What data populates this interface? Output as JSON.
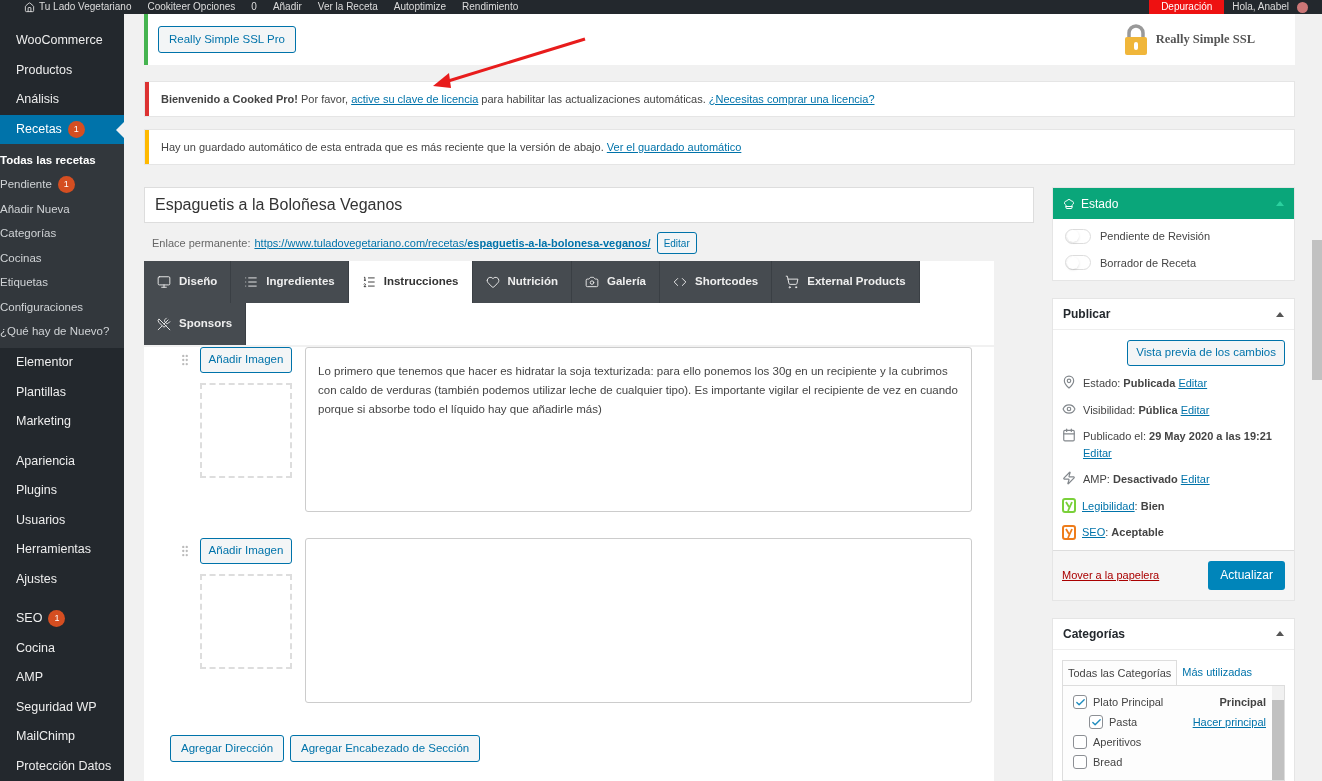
{
  "admin_bar": {
    "items": [
      "Tu Lado Vegetariano",
      "Cookiteer Opciones",
      "0",
      "Añadir",
      "Ver la Receta",
      "Autoptimize",
      "Rendimiento"
    ],
    "debug": "Depuración",
    "greeting": "Hola, Anabel"
  },
  "sidebar": {
    "items": [
      {
        "label": "WooCommerce",
        "selected": false
      },
      {
        "label": "Productos",
        "selected": false
      },
      {
        "label": "Análisis",
        "selected": false
      },
      {
        "label": "Recetas",
        "badge": "1",
        "selected": true,
        "children": [
          {
            "label": "Todas las recetas",
            "selected": true
          },
          {
            "label": "Pendiente",
            "badge": "1",
            "selected": false
          },
          {
            "label": "Añadir Nueva",
            "selected": false
          },
          {
            "label": "Categorías",
            "selected": false
          },
          {
            "label": "Cocinas",
            "selected": false
          },
          {
            "label": "Etiquetas",
            "selected": false
          },
          {
            "label": "Configuraciones",
            "selected": false
          },
          {
            "label": "¿Qué hay de Nuevo?",
            "selected": false
          }
        ]
      },
      {
        "label": "Elementor",
        "selected": false
      },
      {
        "label": "Plantillas",
        "selected": false
      },
      {
        "label": "Marketing",
        "selected": false,
        "gap": true
      },
      {
        "label": "Apariencia",
        "selected": false
      },
      {
        "label": "Plugins",
        "selected": false
      },
      {
        "label": "Usuarios",
        "selected": false
      },
      {
        "label": "Herramientas",
        "selected": false
      },
      {
        "label": "Ajustes",
        "selected": false,
        "gap": true
      },
      {
        "label": "SEO",
        "badge": "1",
        "selected": false
      },
      {
        "label": "Cocina",
        "selected": false
      },
      {
        "label": "AMP",
        "selected": false
      },
      {
        "label": "Seguridad WP",
        "selected": false
      },
      {
        "label": "MailChimp",
        "selected": false
      },
      {
        "label": "Protección Datos",
        "selected": false
      }
    ]
  },
  "notices": [
    {
      "kind": "ssl",
      "color": "#46b450",
      "button": "Really Simple SSL Pro",
      "logo_text": "Really Simple SSL"
    },
    {
      "kind": "message",
      "color": "#dc3232",
      "parts": [
        {
          "text": "**Bienvenido a Cooked Pro!** Por favor, "
        },
        {
          "link": "active su clave de licencia"
        },
        {
          "text": " para habilitar las actualizaciones automáticas. "
        },
        {
          "link": "¿Necesitas comprar una licencia?"
        }
      ]
    },
    {
      "kind": "message",
      "color": "#ffb900",
      "parts": [
        {
          "text": "Hay un guardado automático de esta entrada que es más reciente que la versión de abajo. "
        },
        {
          "link": "Ver el guardado automático"
        }
      ]
    }
  ],
  "title": "Espaguetis a la Boloñesa Veganos",
  "permalink": {
    "label": "Enlace permanente:",
    "url_base": "https://www.tuladovegetariano.com/recetas/",
    "url_slug": "espaguetis-a-la-bolonesa-veganos/",
    "button": "Editar"
  },
  "tabs": [
    {
      "kind": "monitor",
      "label": "Diseño",
      "selected": false
    },
    {
      "kind": "list",
      "label": "Ingredientes",
      "selected": false
    },
    {
      "kind": "ordered",
      "label": "Instrucciones",
      "selected": true
    },
    {
      "kind": "heart",
      "label": "Nutrición",
      "selected": false
    },
    {
      "kind": "camera",
      "label": "Galería",
      "selected": false
    },
    {
      "kind": "code",
      "label": "Shortcodes",
      "selected": false
    },
    {
      "kind": "cart",
      "label": "External Products",
      "selected": false
    },
    {
      "kind": "utensils",
      "label": "Sponsors",
      "selected": false
    }
  ],
  "steps": [
    {
      "button": "Añadir Imagen",
      "text": "Lo primero que tenemos que hacer es hidratar la soja texturizada: para ello ponemos los 30g en un recipiente y la cubrimos con caldo de verduras (también podemos utilizar leche de cualquier tipo). Es importante vigilar el recipiente de vez en cuando porque si absorbe todo el líquido hay que añadirle más)"
    },
    {
      "button": "Añadir Imagen"
    }
  ],
  "step_buttons": [
    "Agregar Dirección",
    "Agregar Encabezado de Sección"
  ],
  "estado": {
    "title": "Estado",
    "toggles": [
      {
        "label": "Pendiente de Revisión",
        "on": false
      },
      {
        "label": "Borrador de Receta",
        "on": false
      }
    ]
  },
  "publicar": {
    "title": "Publicar",
    "preview": "Vista previa de los cambios",
    "rows": [
      {
        "kind": "pin",
        "text": "Estado: **Publicada**",
        "link": "Editar"
      },
      {
        "kind": "eye",
        "text": "Visibilidad: **Pública**",
        "link": "Editar"
      },
      {
        "kind": "calendar",
        "text": "Publicado el: **29 May 2020 a las 19:21**",
        "link": "Editar"
      },
      {
        "kind": "amp",
        "text": "AMP: **Desactivado**",
        "link": "Editar"
      },
      {
        "kind": "yoast",
        "color": "#7ad03a",
        "link": "Legibilidad",
        "text": ": **Bien**"
      },
      {
        "kind": "yoast",
        "color": "#ee7c1b",
        "link": "SEO",
        "text": ": **Aceptable**"
      }
    ],
    "trash": "Mover a la papelera",
    "update": "Actualizar"
  },
  "categorias": {
    "title": "Categorías",
    "tabs": [
      {
        "label": "Todas las Categorías",
        "selected": true
      },
      {
        "label": "Más utilizadas",
        "selected": false
      }
    ],
    "items": [
      {
        "label": "Plato Principal",
        "checked": true,
        "note": "Principal",
        "children": [
          {
            "label": "Pasta",
            "checked": true,
            "link": "Hacer principal"
          }
        ]
      },
      {
        "label": "Aperitivos",
        "checked": false
      },
      {
        "label": "Bread",
        "checked": false
      }
    ]
  }
}
